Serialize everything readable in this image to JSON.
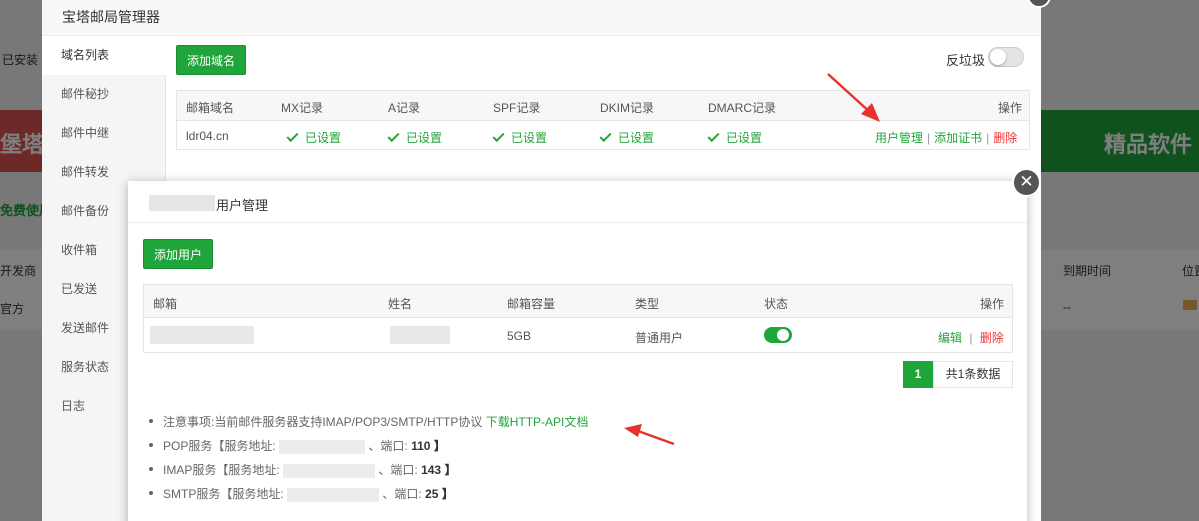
{
  "background": {
    "installed_tab": "已安装",
    "banner_left": "堡塔",
    "banner_right": "精品软件",
    "free_label": "免费使用",
    "developer_header": "开发商",
    "developer_value": "官方",
    "expiry_header": "到期时间",
    "expiry_value": "--",
    "location_header": "位置"
  },
  "mail_dialog": {
    "title": "宝塔邮局管理器",
    "sidebar": [
      {
        "label": "域名列表"
      },
      {
        "label": "邮件秘抄"
      },
      {
        "label": "邮件中继"
      },
      {
        "label": "邮件转发"
      },
      {
        "label": "邮件备份"
      },
      {
        "label": "收件箱"
      },
      {
        "label": "已发送"
      },
      {
        "label": "发送邮件"
      },
      {
        "label": "服务状态"
      },
      {
        "label": "日志"
      }
    ],
    "add_domain_label": "添加域名",
    "antispam_label": "反垃圾",
    "antispam_on": false,
    "domain_table": {
      "headers": [
        "邮箱域名",
        "MX记录",
        "A记录",
        "SPF记录",
        "DKIM记录",
        "DMARC记录",
        "操作"
      ],
      "row": {
        "domain": "ldr04.cn",
        "mx": "已设置",
        "a": "已设置",
        "spf": "已设置",
        "dkim": "已设置",
        "dmarc": "已设置",
        "action_user": "用户管理",
        "action_cert": "添加证书",
        "action_delete": "删除"
      }
    }
  },
  "user_dialog": {
    "title": "用户管理",
    "add_user_label": "添加用户",
    "table": {
      "headers": [
        "邮箱",
        "姓名",
        "邮箱容量",
        "类型",
        "状态",
        "操作"
      ],
      "row": {
        "capacity": "5GB",
        "type": "普通用户",
        "enabled": true,
        "action_edit": "编辑",
        "action_delete": "删除"
      }
    },
    "pager": {
      "current": "1",
      "total": "共1条数据"
    },
    "notes": {
      "note_text": "注意事项:当前邮件服务器支持IMAP/POP3/SMTP/HTTP协议",
      "api_link": "下载HTTP-API文档",
      "pop_label": "POP服务【服务地址:",
      "pop_port_label": "、端口:",
      "pop_port": "110",
      "imap_label": "IMAP服务【服务地址:",
      "imap_port_label": "、端口:",
      "imap_port": "143",
      "smtp_label": "SMTP服务【服务地址:",
      "smtp_port_label": "、端口:",
      "smtp_port": "25",
      "close_bracket": "】"
    }
  },
  "colors": {
    "accent": "#20a53a",
    "danger": "#ee3333",
    "annotation": "#e8322d"
  }
}
